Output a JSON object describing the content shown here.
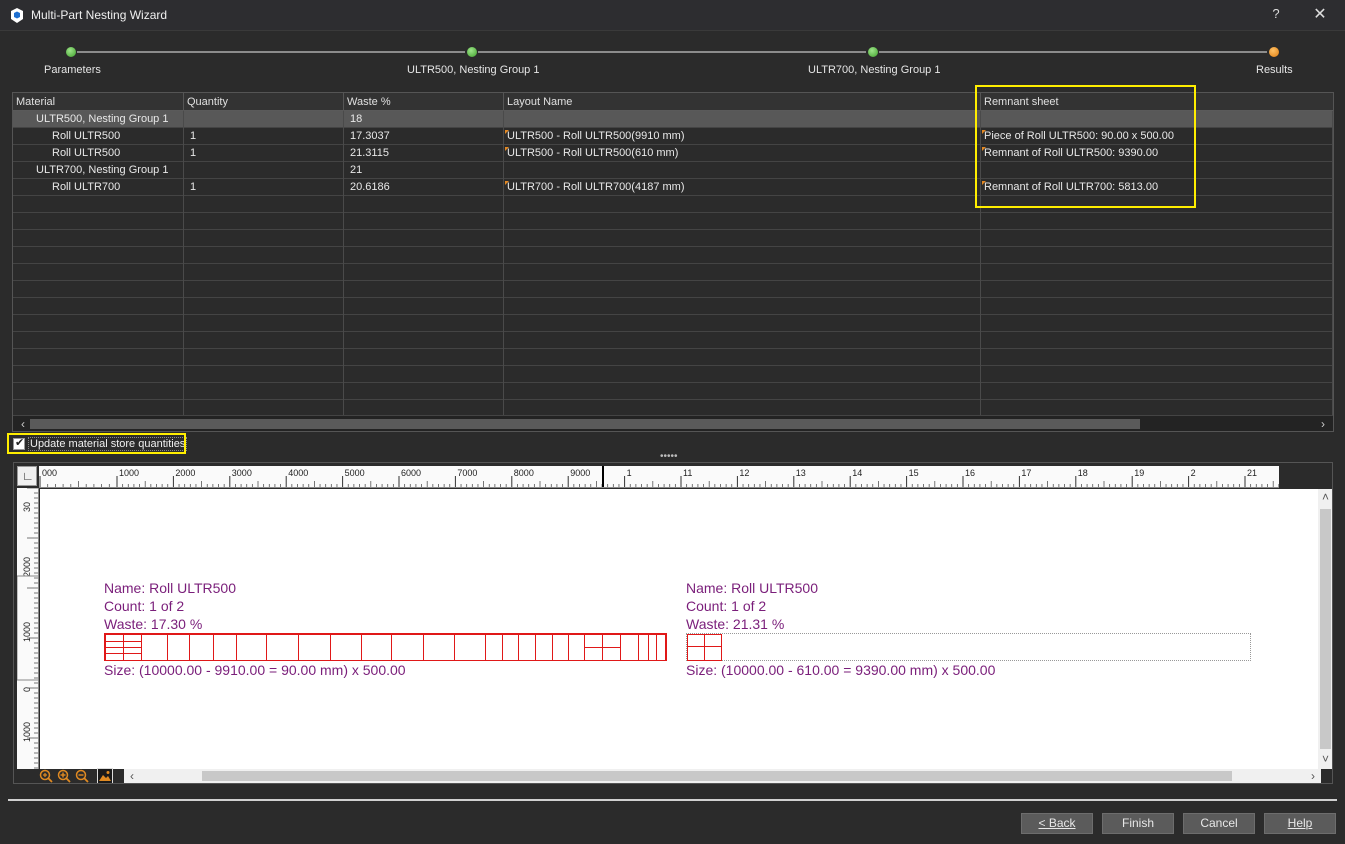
{
  "window": {
    "title": "Multi-Part Nesting Wizard",
    "help_label": "?",
    "close_label": "✕"
  },
  "stepper": {
    "steps": [
      {
        "label": "Parameters",
        "state": "done"
      },
      {
        "label": "ULTR500, Nesting Group 1",
        "state": "done"
      },
      {
        "label": "ULTR700, Nesting Group 1",
        "state": "done"
      },
      {
        "label": "Results",
        "state": "current"
      }
    ]
  },
  "grid": {
    "columns": [
      "Material",
      "Quantity",
      "Waste %",
      "Layout Name",
      "Remnant sheet"
    ],
    "rows": [
      {
        "material": "ULTR500, Nesting Group 1",
        "quantity": "",
        "waste": "18",
        "layout": "",
        "remnant": "",
        "group": true,
        "selected": true
      },
      {
        "material": "Roll ULTR500",
        "quantity": "1",
        "waste": "17.3037",
        "layout": "ULTR500 - Roll ULTR500(9910 mm)",
        "remnant": "Piece of Roll ULTR500: 90.00 x 500.00"
      },
      {
        "material": "Roll ULTR500",
        "quantity": "1",
        "waste": "21.3115",
        "layout": "ULTR500 - Roll ULTR500(610 mm)",
        "remnant": "Remnant of Roll ULTR500: 9390.00"
      },
      {
        "material": "ULTR700, Nesting Group 1",
        "quantity": "",
        "waste": "21",
        "layout": "",
        "remnant": "",
        "group": true
      },
      {
        "material": "Roll ULTR700",
        "quantity": "1",
        "waste": "20.6186",
        "layout": "ULTR700 - Roll ULTR700(4187 mm)",
        "remnant": "Remnant of Roll ULTR700: 5813.00"
      }
    ],
    "scroll_left": "‹",
    "scroll_right": "›"
  },
  "update_store": {
    "label": "Update material store quantities",
    "checked": true,
    "check_glyph": "✔"
  },
  "preview": {
    "corner_glyph": "∟",
    "ruler_top_labels": [
      "000",
      "1000",
      "2000",
      "3000",
      "4000",
      "5000",
      "6000",
      "7000",
      "8000",
      "9000",
      "1",
      "11",
      "12",
      "13",
      "14",
      "15",
      "16",
      "17",
      "18",
      "19",
      "2",
      "21"
    ],
    "ruler_left_labels": [
      "30",
      "2000",
      "1000",
      "0",
      "1000",
      "0"
    ],
    "layouts": [
      {
        "name_line": "Name:  Roll ULTR500",
        "count_line": "Count:  1 of 2",
        "waste_line": "Waste:  17.30 %",
        "size_line": "Size:  (10000.00 - 9910.00 = 90.00 mm) x 500.00"
      },
      {
        "name_line": "Name:  Roll ULTR500",
        "count_line": "Count:  1 of 2",
        "waste_line": "Waste:  21.31 %",
        "size_line": "Size:  (10000.00 - 610.00 = 9390.00 mm) x 500.00"
      }
    ],
    "scroll_up": "˄",
    "scroll_down": "˅",
    "scroll_left": "‹",
    "scroll_right": "›"
  },
  "buttons": {
    "back": "< Back",
    "finish": "Finish",
    "cancel": "Cancel",
    "help": "Help"
  },
  "colors": {
    "step_done": "#3fa02b",
    "step_current": "#e07d10",
    "highlight": "#ffee00",
    "layout_text": "#7a1e7a",
    "part_outline": "#e01818"
  }
}
